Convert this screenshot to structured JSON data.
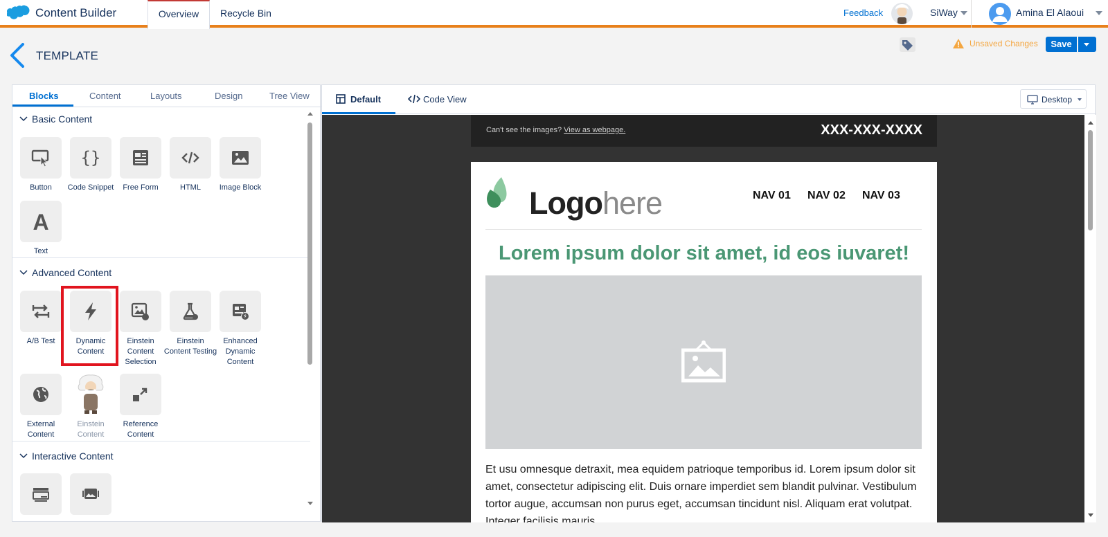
{
  "app": {
    "title": "Content Builder"
  },
  "top_tabs": [
    {
      "label": "Overview"
    },
    {
      "label": "Recycle Bin"
    }
  ],
  "top_right": {
    "feedback": "Feedback",
    "org": "SiWay",
    "user": "Amina El Alaoui"
  },
  "header": {
    "title": "TEMPLATE",
    "unsaved": "Unsaved Changes",
    "save": "Save"
  },
  "left_tabs": [
    "Blocks",
    "Content",
    "Layouts",
    "Design",
    "Tree View"
  ],
  "sections": {
    "basic": {
      "title": "Basic Content",
      "items": [
        "Button",
        "Code Snippet",
        "Free Form",
        "HTML",
        "Image Block",
        "Text"
      ]
    },
    "advanced": {
      "title": "Advanced Content",
      "items": [
        "A/B Test",
        "Dynamic Content",
        "Einstein Content Selection",
        "Einstein Content Testing",
        "Enhanced Dynamic Content",
        "External Content",
        "Einstein Content",
        "Reference Content"
      ]
    },
    "interactive": {
      "title": "Interactive Content"
    }
  },
  "right_tabs": {
    "default": "Default",
    "code": "Code View",
    "device": "Desktop"
  },
  "email": {
    "preheader_text": "Can't see the images?",
    "preheader_link": "View as webpage.",
    "phone": "XXX-XXX-XXXX",
    "logo_bold": "Logo",
    "logo_light": "here",
    "nav": [
      "NAV 01",
      "NAV 02",
      "NAV 03"
    ],
    "headline": "Lorem ipsum dolor sit amet, id eos iuvaret!",
    "body": "Et usu omnesque detraxit, mea equidem patrioque temporibus id. Lorem ipsum dolor sit amet, consectetur adipiscing elit. Duis ornare imperdiet sem blandit pulvinar. Vestibulum tortor augue, accumsan non purus eget, accumsan tincidunt nisl. Aliquam erat volutpat. Integer facilisis mauris."
  },
  "colors": {
    "accent": "#0070d2",
    "topbar_border": "#e8801b",
    "headline": "#4a9774",
    "highlight": "#e1141e"
  }
}
